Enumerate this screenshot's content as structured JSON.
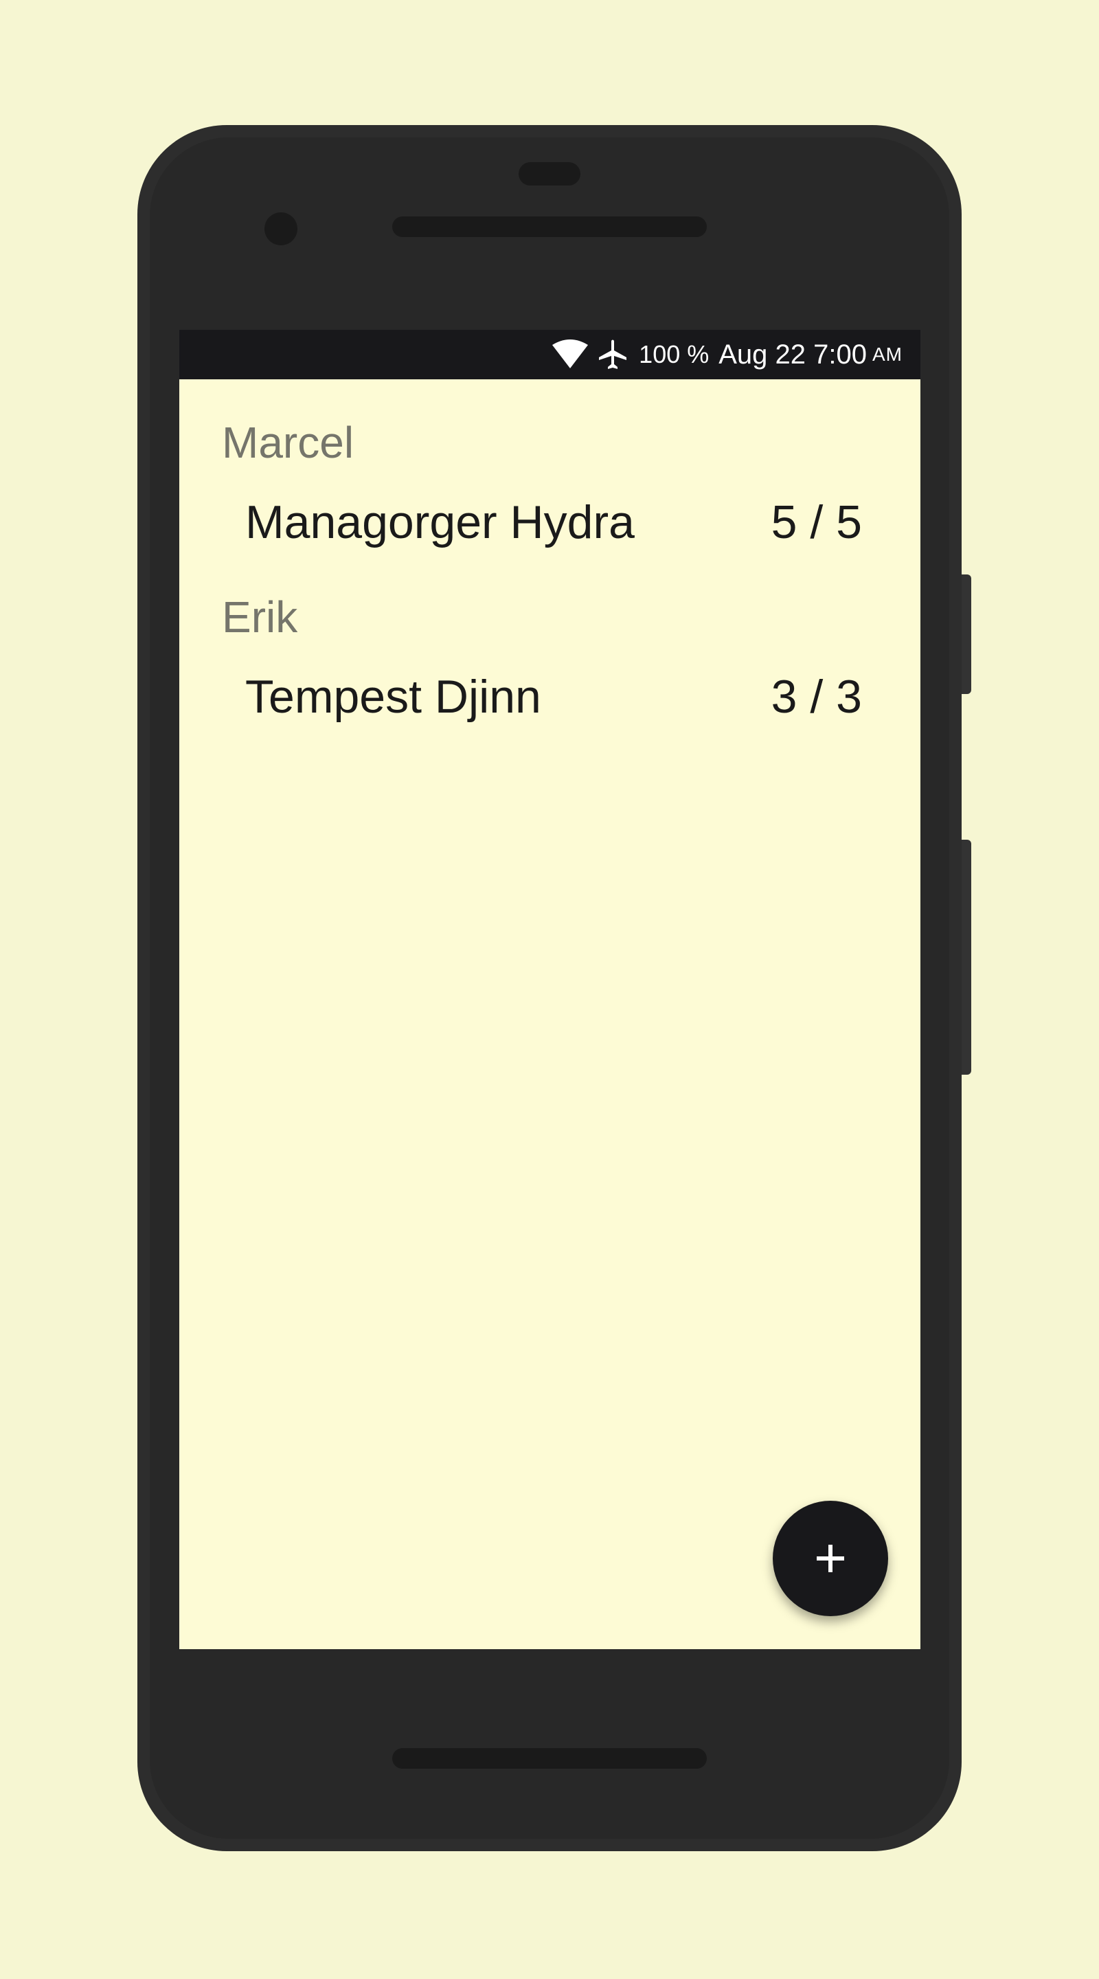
{
  "status_bar": {
    "battery": "100 %",
    "datetime": "Aug 22 7:00",
    "ampm": "AM",
    "icons": [
      "wifi-icon",
      "airplane-icon"
    ]
  },
  "groups": [
    {
      "player": "Marcel",
      "items": [
        {
          "name": "Managorger Hydra",
          "score": "5 / 5"
        }
      ]
    },
    {
      "player": "Erik",
      "items": [
        {
          "name": "Tempest Djinn",
          "score": "3 / 3"
        }
      ]
    }
  ],
  "fab": {
    "icon": "plus-icon"
  },
  "colors": {
    "page_background": "#f6f6d2",
    "screen_background": "#fdfbd5",
    "status_bar": "#18181b",
    "group_header_text": "#75756b",
    "row_text": "#1a1a1a",
    "fab": "#18181b"
  }
}
